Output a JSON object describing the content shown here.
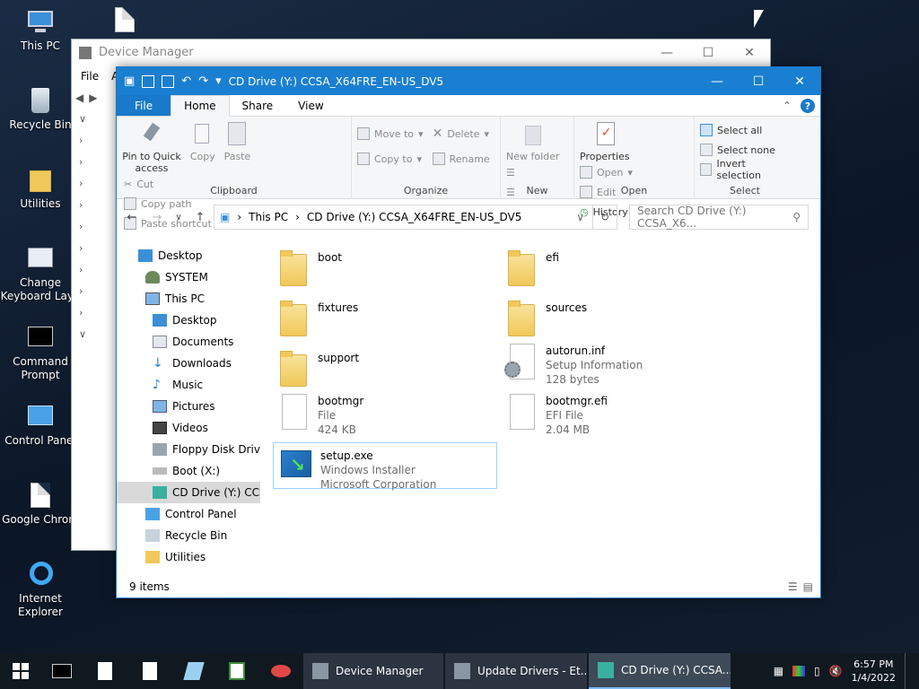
{
  "desktop": {
    "icons": [
      {
        "label": "This PC",
        "icon": "computer-icon"
      },
      {
        "label": "Recycle Bin",
        "icon": "recycle-bin-icon"
      },
      {
        "label": "Utilities",
        "icon": "folder-icon"
      },
      {
        "label": "Change Keyboard Layo",
        "icon": "keyboard-icon"
      },
      {
        "label": "Command Prompt",
        "icon": "cmd-icon"
      },
      {
        "label": "Control Panel",
        "icon": "control-panel-icon"
      },
      {
        "label": "Google Chrom",
        "icon": "file-icon"
      },
      {
        "label": "Internet Explorer",
        "icon": "ie-icon"
      }
    ]
  },
  "device_manager": {
    "title": "Device Manager",
    "menu": [
      "File",
      "A"
    ]
  },
  "explorer": {
    "title": "CD Drive (Y:) CCSA_X64FRE_EN-US_DV5",
    "tabs": {
      "file": "File",
      "home": "Home",
      "share": "Share",
      "view": "View"
    },
    "ribbon": {
      "clipboard": {
        "name": "Clipboard",
        "pin": "Pin to Quick access",
        "copy": "Copy",
        "paste": "Paste",
        "cut": "Cut",
        "copy_path": "Copy path",
        "paste_shortcut": "Paste shortcut"
      },
      "organize": {
        "name": "Organize",
        "move_to": "Move to",
        "copy_to": "Copy to",
        "delete": "Delete",
        "rename": "Rename"
      },
      "new": {
        "name": "New",
        "new_folder": "New folder"
      },
      "open": {
        "name": "Open",
        "properties": "Properties",
        "open": "Open",
        "edit": "Edit",
        "history": "History"
      },
      "select": {
        "name": "Select",
        "select_all": "Select all",
        "select_none": "Select none",
        "invert": "Invert selection"
      }
    },
    "address": {
      "crumbs": [
        "This PC",
        "CD Drive (Y:) CCSA_X64FRE_EN-US_DV5"
      ],
      "search_placeholder": "Search CD Drive (Y:) CCSA_X6..."
    },
    "nav": [
      {
        "label": "Desktop",
        "indent": 0
      },
      {
        "label": "SYSTEM",
        "indent": 1
      },
      {
        "label": "This PC",
        "indent": 1
      },
      {
        "label": "Desktop",
        "indent": 2
      },
      {
        "label": "Documents",
        "indent": 2
      },
      {
        "label": "Downloads",
        "indent": 2
      },
      {
        "label": "Music",
        "indent": 2
      },
      {
        "label": "Pictures",
        "indent": 2
      },
      {
        "label": "Videos",
        "indent": 2
      },
      {
        "label": "Floppy Disk Drive",
        "indent": 2
      },
      {
        "label": "Boot (X:)",
        "indent": 2
      },
      {
        "label": "CD Drive (Y:) CCSA",
        "indent": 2
      },
      {
        "label": "Control Panel",
        "indent": 1
      },
      {
        "label": "Recycle Bin",
        "indent": 1
      },
      {
        "label": "Utilities",
        "indent": 1
      }
    ],
    "items": [
      {
        "name": "boot",
        "type": "folder",
        "line2": "",
        "line3": ""
      },
      {
        "name": "efi",
        "type": "folder",
        "line2": "",
        "line3": ""
      },
      {
        "name": "fixtures",
        "type": "folder",
        "line2": "",
        "line3": ""
      },
      {
        "name": "sources",
        "type": "folder",
        "line2": "",
        "line3": ""
      },
      {
        "name": "support",
        "type": "folder",
        "line2": "",
        "line3": ""
      },
      {
        "name": "autorun.inf",
        "type": "inf",
        "line2": "Setup Information",
        "line3": "128 bytes"
      },
      {
        "name": "bootmgr",
        "type": "file",
        "line2": "File",
        "line3": "424 KB"
      },
      {
        "name": "bootmgr.efi",
        "type": "file",
        "line2": "EFI File",
        "line3": "2.04 MB"
      },
      {
        "name": "setup.exe",
        "type": "exe",
        "line2": "Windows Installer",
        "line3": "Microsoft Corporation"
      }
    ],
    "status": "9 items"
  },
  "taskbar": {
    "apps": [
      {
        "label": "Device Manager"
      },
      {
        "label": "Update Drivers - Et..."
      },
      {
        "label": "CD Drive (Y:) CCSA..."
      }
    ],
    "time": "6:57 PM",
    "date": "1/4/2022"
  },
  "colors": {
    "accent": "#1979ca",
    "folder": "#f1c85a",
    "taskbar": "#101820"
  }
}
